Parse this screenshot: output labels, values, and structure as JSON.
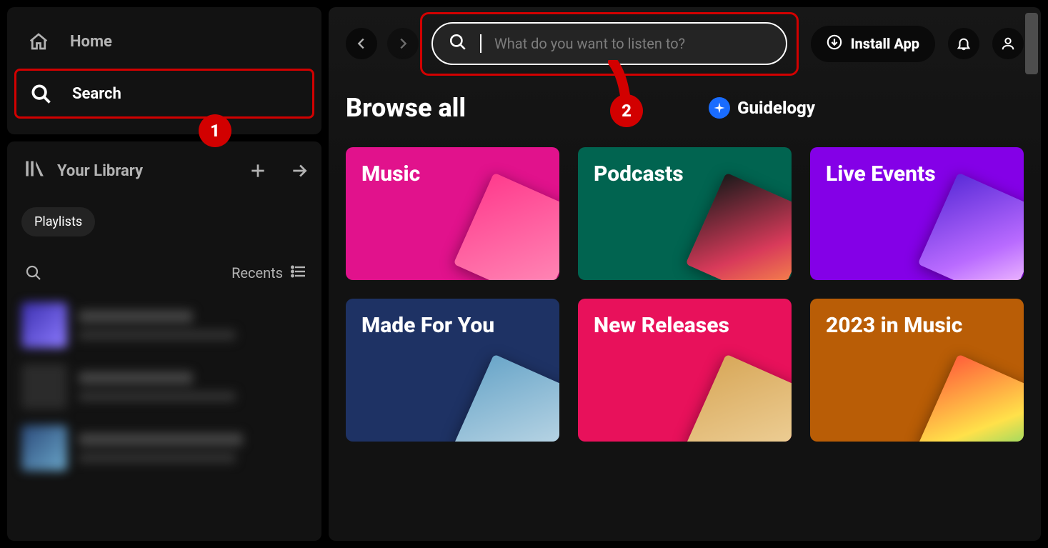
{
  "sidebar": {
    "home_label": "Home",
    "search_label": "Search",
    "library_label": "Your Library",
    "chip_playlists": "Playlists",
    "recents_label": "Recents"
  },
  "topbar": {
    "search_placeholder": "What do you want to listen to?",
    "install_label": "Install App"
  },
  "main": {
    "heading": "Browse all",
    "watermark": "Guidelogy",
    "cards": [
      {
        "label": "Music",
        "color": "#e1128c",
        "art": "linear-gradient(135deg,#ff3b8d,#ff8fb9)"
      },
      {
        "label": "Podcasts",
        "color": "#016450",
        "art": "linear-gradient(135deg,#1a1a1a,#d83a5a 60%,#ff9b46)"
      },
      {
        "label": "Live Events",
        "color": "#8400e7",
        "art": "linear-gradient(135deg,#5a2bd8,#b96bff 60%,#ffd1ff)"
      },
      {
        "label": "Made For You",
        "color": "#1e3264",
        "art": "linear-gradient(135deg,#6aa6c9,#cfe2ec)"
      },
      {
        "label": "New Releases",
        "color": "#e8115b",
        "art": "linear-gradient(135deg,#d8a85a,#f3d9a6)"
      },
      {
        "label": "2023 in Music",
        "color": "#b95d06",
        "art": "linear-gradient(135deg,#ff5e3a,#ffe14a 55%,#2fd27a)"
      }
    ]
  },
  "annotations": {
    "one": "1",
    "two": "2"
  },
  "playlist_art": [
    "linear-gradient(135deg,#3b2fae,#8d7bff)",
    "#2b2b2b",
    "linear-gradient(135deg,#2b4a7a,#6aa6c9)"
  ]
}
